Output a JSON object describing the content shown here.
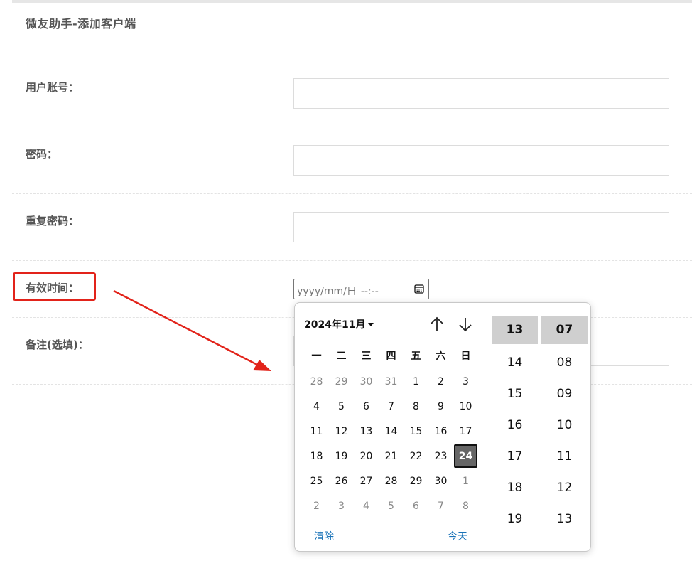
{
  "page": {
    "title": "微友助手-添加客户端"
  },
  "form": {
    "account_label": "用户账号：",
    "password_label": "密码：",
    "repeat_password_label": "重复密码：",
    "valid_time_label": "有效时间：",
    "note_label": "备注(选填)：",
    "datetime_placeholder_date": "yyyy/mm/日",
    "datetime_placeholder_time": "--:--"
  },
  "picker": {
    "month_label": "2024年11月",
    "weekdays": [
      "一",
      "二",
      "三",
      "四",
      "五",
      "六",
      "日"
    ],
    "days": [
      {
        "d": "28",
        "other": true
      },
      {
        "d": "29",
        "other": true
      },
      {
        "d": "30",
        "other": true
      },
      {
        "d": "31",
        "other": true
      },
      {
        "d": "1"
      },
      {
        "d": "2"
      },
      {
        "d": "3"
      },
      {
        "d": "4"
      },
      {
        "d": "5"
      },
      {
        "d": "6"
      },
      {
        "d": "7"
      },
      {
        "d": "8"
      },
      {
        "d": "9"
      },
      {
        "d": "10"
      },
      {
        "d": "11"
      },
      {
        "d": "12"
      },
      {
        "d": "13"
      },
      {
        "d": "14"
      },
      {
        "d": "15"
      },
      {
        "d": "16"
      },
      {
        "d": "17"
      },
      {
        "d": "18"
      },
      {
        "d": "19"
      },
      {
        "d": "20"
      },
      {
        "d": "21"
      },
      {
        "d": "22"
      },
      {
        "d": "23"
      },
      {
        "d": "24",
        "today": true
      },
      {
        "d": "25"
      },
      {
        "d": "26"
      },
      {
        "d": "27"
      },
      {
        "d": "28"
      },
      {
        "d": "29"
      },
      {
        "d": "30"
      },
      {
        "d": "1",
        "other": true
      },
      {
        "d": "2",
        "other": true
      },
      {
        "d": "3",
        "other": true
      },
      {
        "d": "4",
        "other": true
      },
      {
        "d": "5",
        "other": true
      },
      {
        "d": "6",
        "other": true
      },
      {
        "d": "7",
        "other": true
      },
      {
        "d": "8",
        "other": true
      }
    ],
    "clear_label": "清除",
    "today_label": "今天",
    "hours": [
      "13",
      "14",
      "15",
      "16",
      "17",
      "18",
      "19"
    ],
    "minutes": [
      "07",
      "08",
      "09",
      "10",
      "11",
      "12",
      "13"
    ],
    "selected_hour": "13",
    "selected_minute": "07"
  },
  "colors": {
    "highlight": "#e2231a",
    "arrow": "#e2231a",
    "link": "#1a73b8",
    "selected_day_bg": "#666666",
    "selected_time_bg": "#cfcfcf"
  },
  "icons": {
    "calendar": "calendar-icon",
    "prev_month": "arrow-up-icon",
    "next_month": "arrow-down-icon",
    "month_dropdown": "caret-down-icon"
  }
}
